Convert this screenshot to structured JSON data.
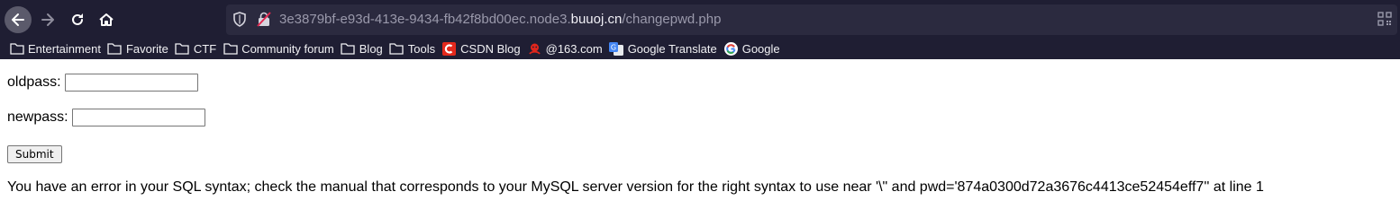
{
  "browser": {
    "url_prefix": "3e3879bf-e93d-413e-9434-fb42f8bd00ec.node3.",
    "url_host": "buuoj.cn",
    "url_path": "/changepwd.php",
    "icons": [
      "back-arrow-icon",
      "forward-arrow-icon",
      "reload-icon",
      "home-icon",
      "shield-icon",
      "insecure-lock-icon",
      "qr-code-icon"
    ],
    "colors": {
      "toolbar": "#1f1e33",
      "urlbar": "#2b2a3f"
    }
  },
  "bookmarks": [
    {
      "label": "Entertainment",
      "icon": "folder-icon"
    },
    {
      "label": "Favorite",
      "icon": "folder-icon"
    },
    {
      "label": "CTF",
      "icon": "folder-icon"
    },
    {
      "label": "Community forum",
      "icon": "folder-icon"
    },
    {
      "label": "Blog",
      "icon": "folder-icon"
    },
    {
      "label": "Tools",
      "icon": "folder-icon"
    },
    {
      "label": "CSDN Blog",
      "icon": "csdn-icon"
    },
    {
      "label": "@163.com",
      "icon": "163-mail-icon"
    },
    {
      "label": "Google Translate",
      "icon": "google-translate-icon"
    },
    {
      "label": "Google",
      "icon": "google-icon"
    }
  ],
  "form": {
    "oldpass_label": "oldpass:",
    "oldpass_value": "",
    "newpass_label": "newpass:",
    "newpass_value": "",
    "submit_label": "Submit"
  },
  "error_message": "You have an error in your SQL syntax; check the manual that corresponds to your MySQL server version for the right syntax to use near '\\\" and pwd='874a0300d72a3676c4413ce52454eff7'' at line 1"
}
